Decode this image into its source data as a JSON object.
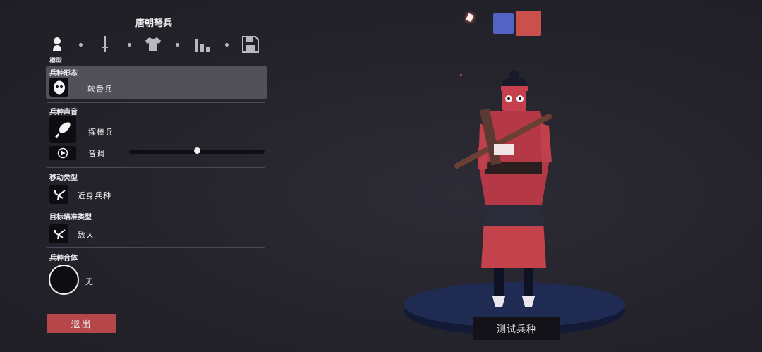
{
  "header": {
    "title": "唐朝弩兵"
  },
  "tabs": {
    "caption": "模型",
    "items": [
      {
        "icon": "person-icon"
      },
      {
        "icon": "sword-icon"
      },
      {
        "icon": "shirt-icon"
      },
      {
        "icon": "stats-bars-icon"
      },
      {
        "icon": "save-disk-icon"
      }
    ]
  },
  "sections": {
    "form": {
      "label": "兵种形态",
      "value": "软骨兵",
      "icon": "mask-face-icon"
    },
    "sound": {
      "label": "兵种声音",
      "value": "挥棒兵",
      "icon": "club-icon",
      "pitch_label": "音调",
      "pitch_level": 0.5,
      "play_icon": "play-icon"
    },
    "movement": {
      "label": "移动类型",
      "value": "近身兵种",
      "icon": "running-figure-icon"
    },
    "targeting": {
      "label": "目标瞄准类型",
      "value": "敌人",
      "icon": "running-figure-icon"
    },
    "combine": {
      "label": "兵种合体",
      "value": "无",
      "icon": "empty-circle-icon"
    }
  },
  "buttons": {
    "exit": "退出",
    "test": "测试兵种"
  },
  "team_colors": {
    "blue": "#5363c4",
    "red": "#c9504d"
  },
  "colors": {
    "accent_red": "#b5474a",
    "selected_bg": "#52515a",
    "background": "#24232b"
  }
}
